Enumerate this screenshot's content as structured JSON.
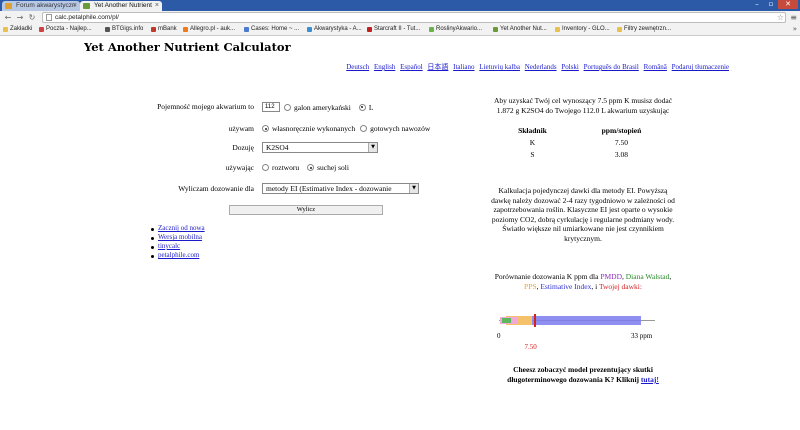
{
  "browser": {
    "tabs": [
      {
        "title": "Forum akwarystyczn",
        "active": false
      },
      {
        "title": "Yet Another Nutrient",
        "active": true
      }
    ],
    "url": "calc.petalphile.com/pl/",
    "bookmarks": [
      "Zakładki",
      "Poczta - Najlep...",
      "BTGigs.info",
      "mBank",
      "Allegro.pl - auk...",
      "Cases: Home ~ ...",
      "Akwarystyka - A...",
      "Starcraft II - Tut...",
      "RoslinyAkwario...",
      "Yet Another Nut...",
      "Inventory - GLO...",
      "Filtry zewnętrzn..."
    ],
    "bookmarks_more": "»"
  },
  "page": {
    "title": "Yet Another Nutrient Calculator",
    "languages": [
      "Deutsch",
      "English",
      "Español",
      "日本語",
      "Italiano",
      "Lietuvių kalba",
      "Nederlands",
      "Polski",
      "Português do Brasil",
      "Română",
      "Podaruj tłumaczenie"
    ]
  },
  "form": {
    "tank_label": "Pojemność mojego akwarium to",
    "tank_volume": "112",
    "unit_gallon": "galon amerykański",
    "unit_liter": "L",
    "using_label": "używam",
    "diy_label": "własnoręcznie wykonanych",
    "premade_label": "gotowych nawozów",
    "dose_label": "Dozuję",
    "compound": "K2SO4",
    "using2_label": "używając",
    "solution_label": "roztworu",
    "dry_label": "suchej soli",
    "method_label": "Wyliczam dozowanie dla",
    "method": "metody EI (Estimative Index - dozowanie",
    "submit": "Wylicz"
  },
  "links": [
    "Zacznij od nowa",
    "Wersja mobilna",
    "tinycalc",
    "petalphile.com"
  ],
  "results": {
    "summary": "Aby uzyskać Twój cel wynoszący 7.5 ppm K musisz dodać 1.872 g K2SO4 do Twojego 112.0 L akwarium uzyskując",
    "table_headers": [
      "Składnik",
      "ppm/stopień"
    ],
    "table_rows": [
      [
        "K",
        "7.50"
      ],
      [
        "S",
        "3.08"
      ]
    ],
    "ei_description": "Kalkulacja pojedynczej dawki dla metody EI. Powyższą dawkę należy dozować 2-4 razy tygodniowo w zależności od zapotrzebowania roślin. Klasyczne EI jest oparte o wysokie poziomy CO2, dobrą cyrkulację i regularne podmiany wody. Światło większe nil umiarkowane nie jest czynnikiem krytycznym.",
    "compare_intro": "Porównanie dozowania K ppm dla",
    "compare_pmdd": "PMDD",
    "compare_walstad": "Diana Walstad",
    "compare_pps": "PPS",
    "compare_ei": "Estimative Index",
    "compare_and": "i",
    "compare_twoje": "Twojej dawki:",
    "axis_min": "0",
    "axis_max": "33 ppm",
    "dose_value": "7.50",
    "range_max_ppm": 33,
    "ranges": [
      {
        "name": "PMDD",
        "from": 0.3,
        "to": 4.0,
        "color": "#f1a9d8"
      },
      {
        "name": "Diana Walstad",
        "from": 0.6,
        "to": 2.5,
        "color": "#5cb85c"
      },
      {
        "name": "PPS",
        "from": 1.5,
        "to": 7.0,
        "color": "#f5c26b"
      },
      {
        "name": "Estimative Index",
        "from": 3.0,
        "to": 30.0,
        "color": "#7b7bf0"
      },
      {
        "name": "Twoja dawka",
        "from": 7.3,
        "to": 7.7,
        "color": "#d62020"
      }
    ],
    "model_question": "Cheesz zobaczyć model prezentujący skutki długoterminowego dozowania K? Kliknij",
    "model_link": "tutaj!"
  },
  "colors": {
    "tab_bar": "#2c5aa6",
    "link": "#1a1acc",
    "dose": "#d62020"
  }
}
